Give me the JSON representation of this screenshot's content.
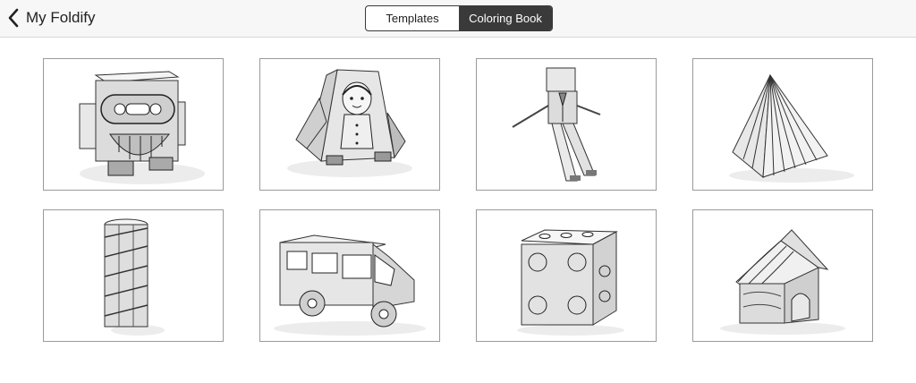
{
  "header": {
    "back_label": "My Foldify",
    "tabs": [
      {
        "label": "Templates",
        "active": false
      },
      {
        "label": "Coloring Book",
        "active": true
      }
    ]
  },
  "templates": [
    {
      "name": "robot"
    },
    {
      "name": "girl"
    },
    {
      "name": "businessman"
    },
    {
      "name": "pyramid"
    },
    {
      "name": "striped-column"
    },
    {
      "name": "van"
    },
    {
      "name": "dice"
    },
    {
      "name": "house"
    }
  ],
  "colors": {
    "active_tab_bg": "#3a3a3a",
    "card_border": "#9a9a9a"
  }
}
